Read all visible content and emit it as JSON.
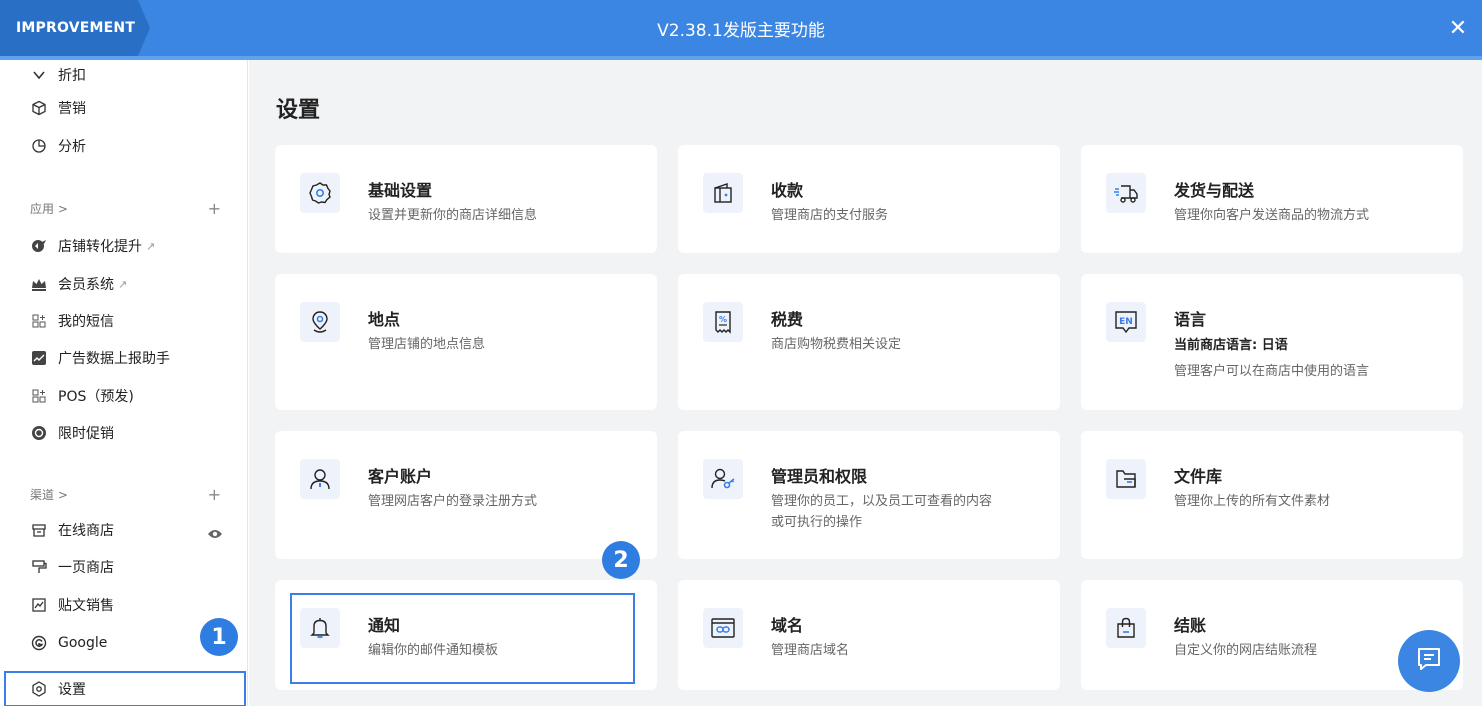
{
  "header": {
    "tag": "IMPROVEMENT",
    "title": "V2.38.1发版主要功能",
    "close": "✕"
  },
  "sidebar": {
    "top_items": [
      {
        "label": "折扣",
        "icon": "chevron-down-icon"
      },
      {
        "label": "营销",
        "icon": "cube-icon"
      },
      {
        "label": "分析",
        "icon": "pie-chart-icon"
      }
    ],
    "apps_section": {
      "label": "应用 >",
      "add": "+"
    },
    "apps": [
      {
        "label": "店铺转化提升",
        "icon": "conversion-app-icon",
        "external": true
      },
      {
        "label": "会员系统",
        "icon": "crown-icon",
        "external": true
      },
      {
        "label": "我的短信",
        "icon": "sms-grid-icon"
      },
      {
        "label": "广告数据上报助手",
        "icon": "ads-report-icon"
      },
      {
        "label": "POS（预发)",
        "icon": "pos-grid-icon"
      },
      {
        "label": "限时促销",
        "icon": "timer-icon"
      }
    ],
    "channels_section": {
      "label": "渠道 >",
      "add": "+"
    },
    "channels": [
      {
        "label": "在线商店",
        "icon": "store-icon"
      },
      {
        "label": "一页商店",
        "icon": "paint-roller-icon"
      },
      {
        "label": "贴文销售",
        "icon": "post-sale-icon"
      },
      {
        "label": "Google",
        "icon": "google-icon"
      }
    ],
    "settings": {
      "label": "设置",
      "icon": "settings-icon"
    },
    "external_mark": "↗"
  },
  "main": {
    "title": "设置",
    "cards": [
      {
        "title": "基础设置",
        "desc": "设置并更新你的商店详细信息",
        "icon": "gear-icon"
      },
      {
        "title": "收款",
        "desc": "管理商店的支付服务",
        "icon": "wallet-icon"
      },
      {
        "title": "发货与配送",
        "desc": "管理你向客户发送商品的物流方式",
        "icon": "truck-icon"
      },
      {
        "title": "地点",
        "desc": "管理店铺的地点信息",
        "icon": "location-pin-icon"
      },
      {
        "title": "税费",
        "desc": "商店购物税费相关设定",
        "icon": "tax-receipt-icon"
      },
      {
        "title": "语言",
        "strong": "当前商店语言: 日语",
        "desc": "管理客户可以在商店中使用的语言",
        "icon": "language-icon",
        "icon_text": "EN"
      },
      {
        "title": "客户账户",
        "desc": "管理网店客户的登录注册方式",
        "icon": "customer-icon"
      },
      {
        "title": "管理员和权限",
        "desc": "管理你的员工，以及员工可查看的内容或可执行的操作",
        "icon": "admin-key-icon"
      },
      {
        "title": "文件库",
        "desc": "管理你上传的所有文件素材",
        "icon": "folder-icon"
      },
      {
        "title": "通知",
        "desc": "编辑你的邮件通知模板",
        "icon": "bell-icon"
      },
      {
        "title": "域名",
        "desc": "管理商店域名",
        "icon": "domain-link-icon"
      },
      {
        "title": "结账",
        "desc": "自定义你的网店结账流程",
        "icon": "shopping-bag-icon"
      }
    ]
  },
  "annotations": {
    "step1": "1",
    "step2": "2"
  },
  "colors": {
    "primary": "#3b86e3",
    "highlight": "#3b7de9",
    "background": "#f2f3f5"
  }
}
